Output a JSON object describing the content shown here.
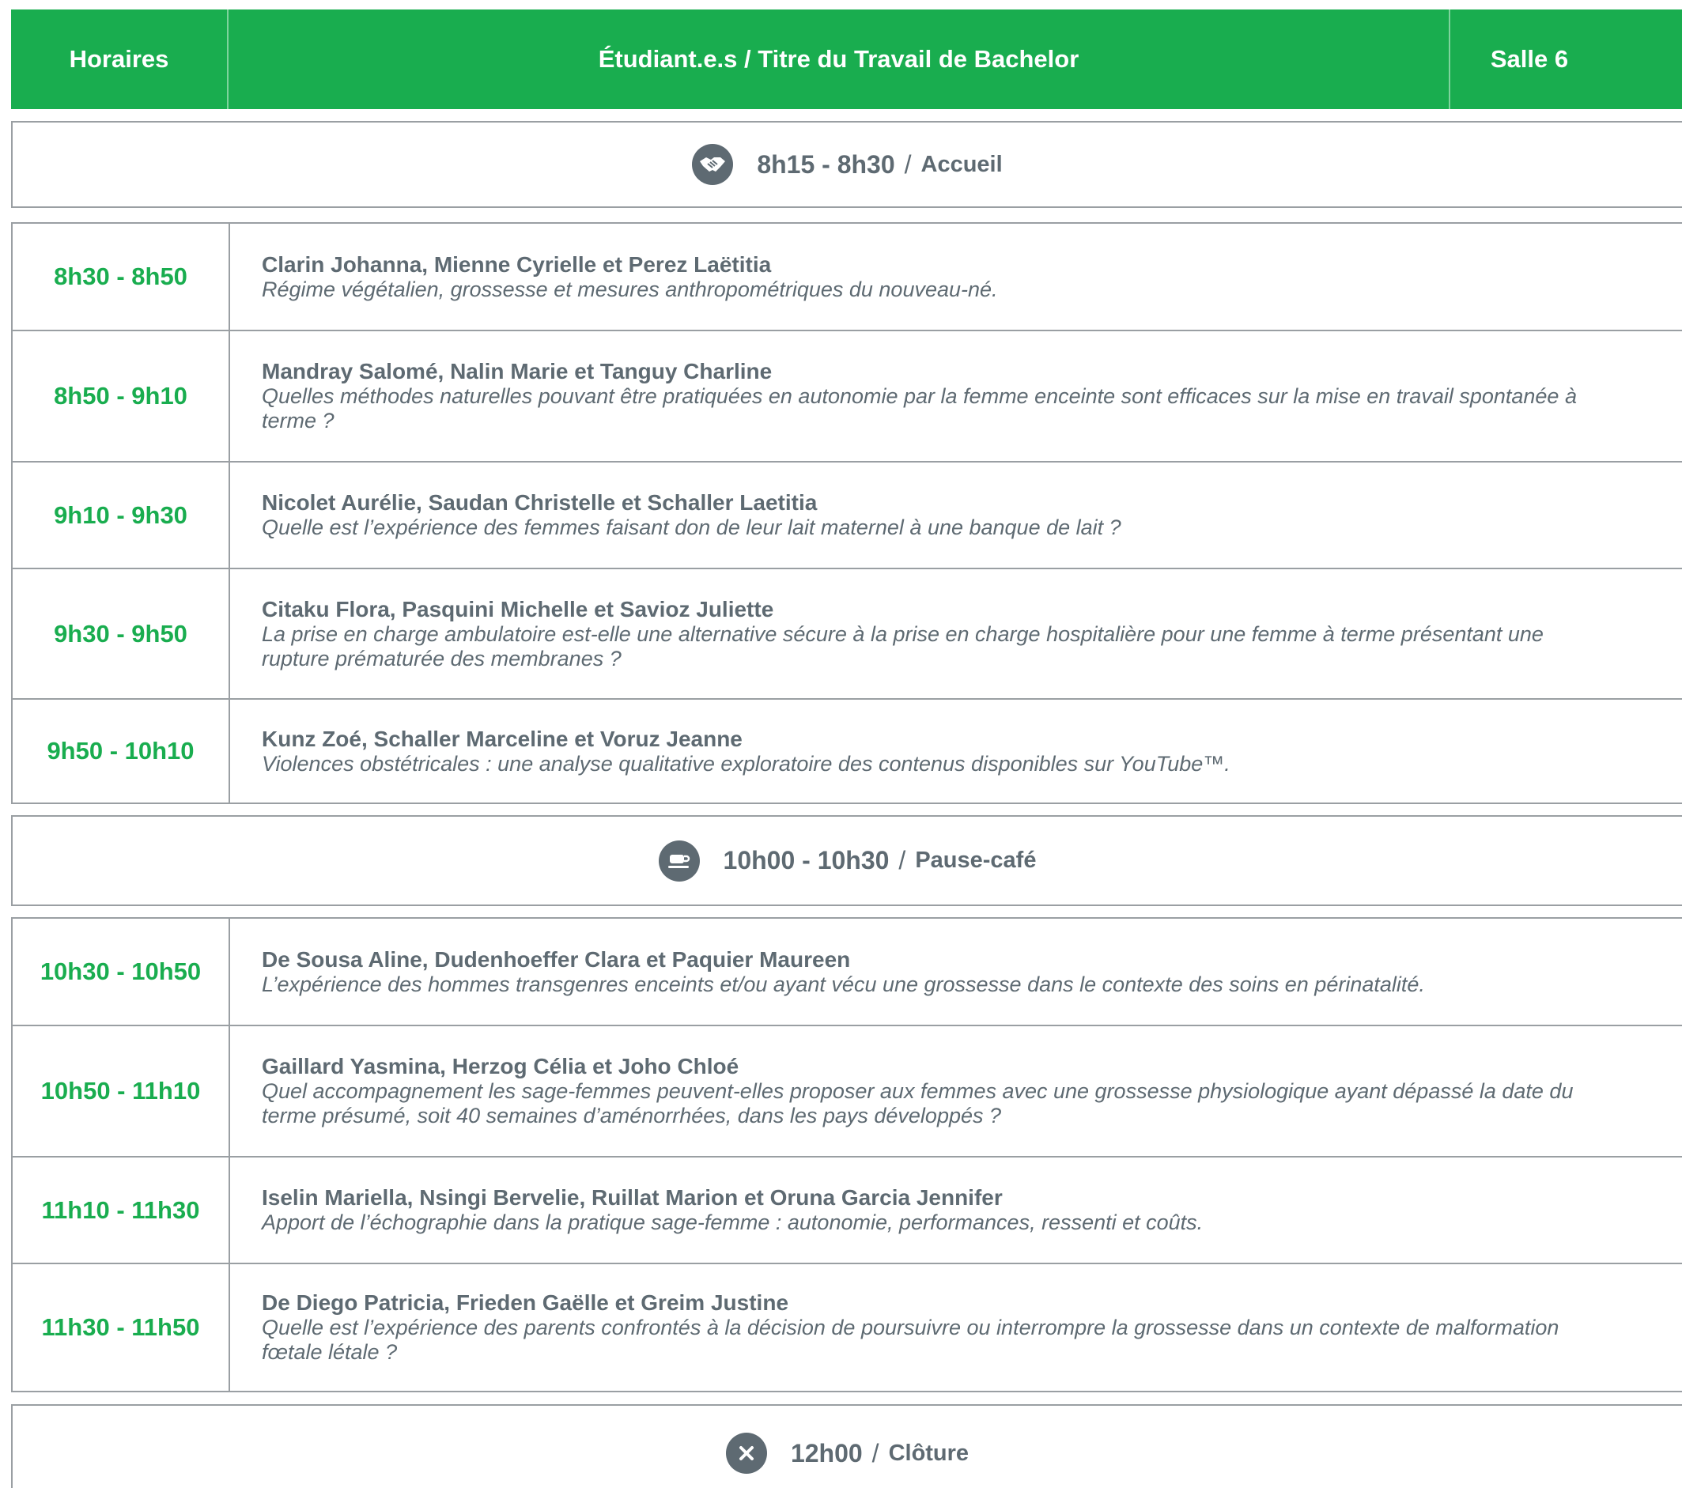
{
  "header": {
    "col_time": "Horaires",
    "col_title": "Étudiant.e.s / Titre du Travail de Bachelor",
    "col_room": "Salle 6"
  },
  "breaks": [
    {
      "icon": "handshake-icon",
      "time": "8h15 - 8h30",
      "label": "Accueil"
    },
    {
      "icon": "coffee-cup-icon",
      "time": "10h00 - 10h30",
      "label": "Pause-café"
    },
    {
      "icon": "close-icon",
      "time": "12h00",
      "label": "Clôture"
    }
  ],
  "sessions_morning": [
    {
      "time": "8h30 - 8h50",
      "names": "Clarin Johanna, Mienne Cyrielle et Perez Laëtitia",
      "title": "Régime végétalien, grossesse et mesures anthropométriques du nouveau-né."
    },
    {
      "time": "8h50 - 9h10",
      "names": "Mandray Salomé, Nalin Marie et Tanguy Charline",
      "title": "Quelles méthodes naturelles pouvant être pratiquées en autonomie par la femme enceinte sont efficaces sur la mise en travail spontanée à terme ?"
    },
    {
      "time": "9h10 - 9h30",
      "names": "Nicolet Aurélie, Saudan Christelle et Schaller Laetitia",
      "title": "Quelle est l’expérience des femmes faisant don de leur lait maternel à une banque de lait ?"
    },
    {
      "time": "9h30 - 9h50",
      "names": "Citaku Flora, Pasquini Michelle et Savioz Juliette",
      "title": "La prise en charge ambulatoire est-elle une alternative sécure à la prise en charge hospitalière pour une femme à terme présentant une rupture prématurée des membranes ?"
    },
    {
      "time": "9h50 - 10h10",
      "names": "Kunz Zoé, Schaller Marceline et Voruz Jeanne",
      "title": "Violences obstétricales : une analyse qualitative exploratoire des contenus disponibles sur YouTube™."
    }
  ],
  "sessions_late": [
    {
      "time": "10h30 - 10h50",
      "names": "De Sousa Aline, Dudenhoeffer Clara et Paquier Maureen",
      "title": "L’expérience des hommes transgenres enceints et/ou ayant vécu une grossesse dans le contexte des soins en périnatalité."
    },
    {
      "time": "10h50 - 11h10",
      "names": "Gaillard Yasmina, Herzog Célia et Joho Chloé",
      "title": "Quel accompagnement les sage-femmes peuvent-elles proposer aux femmes avec une grossesse physiologique ayant dépassé la date du terme présumé, soit 40 semaines d’aménorrhées, dans les pays développés ?"
    },
    {
      "time": "11h10 - 11h30",
      "names": "Iselin Mariella, Nsingi Bervelie, Ruillat Marion et Oruna Garcia Jennifer",
      "title": "Apport de l’échographie dans la pratique sage-femme : autonomie, performances, ressenti et coûts."
    },
    {
      "time": "11h30 - 11h50",
      "names": "De Diego Patricia, Frieden Gaëlle et Greim Justine",
      "title": "Quelle est l’expérience des parents confrontés à la décision de poursuivre ou interrompre la grossesse dans un contexte de malformation fœtale létale ?"
    }
  ]
}
